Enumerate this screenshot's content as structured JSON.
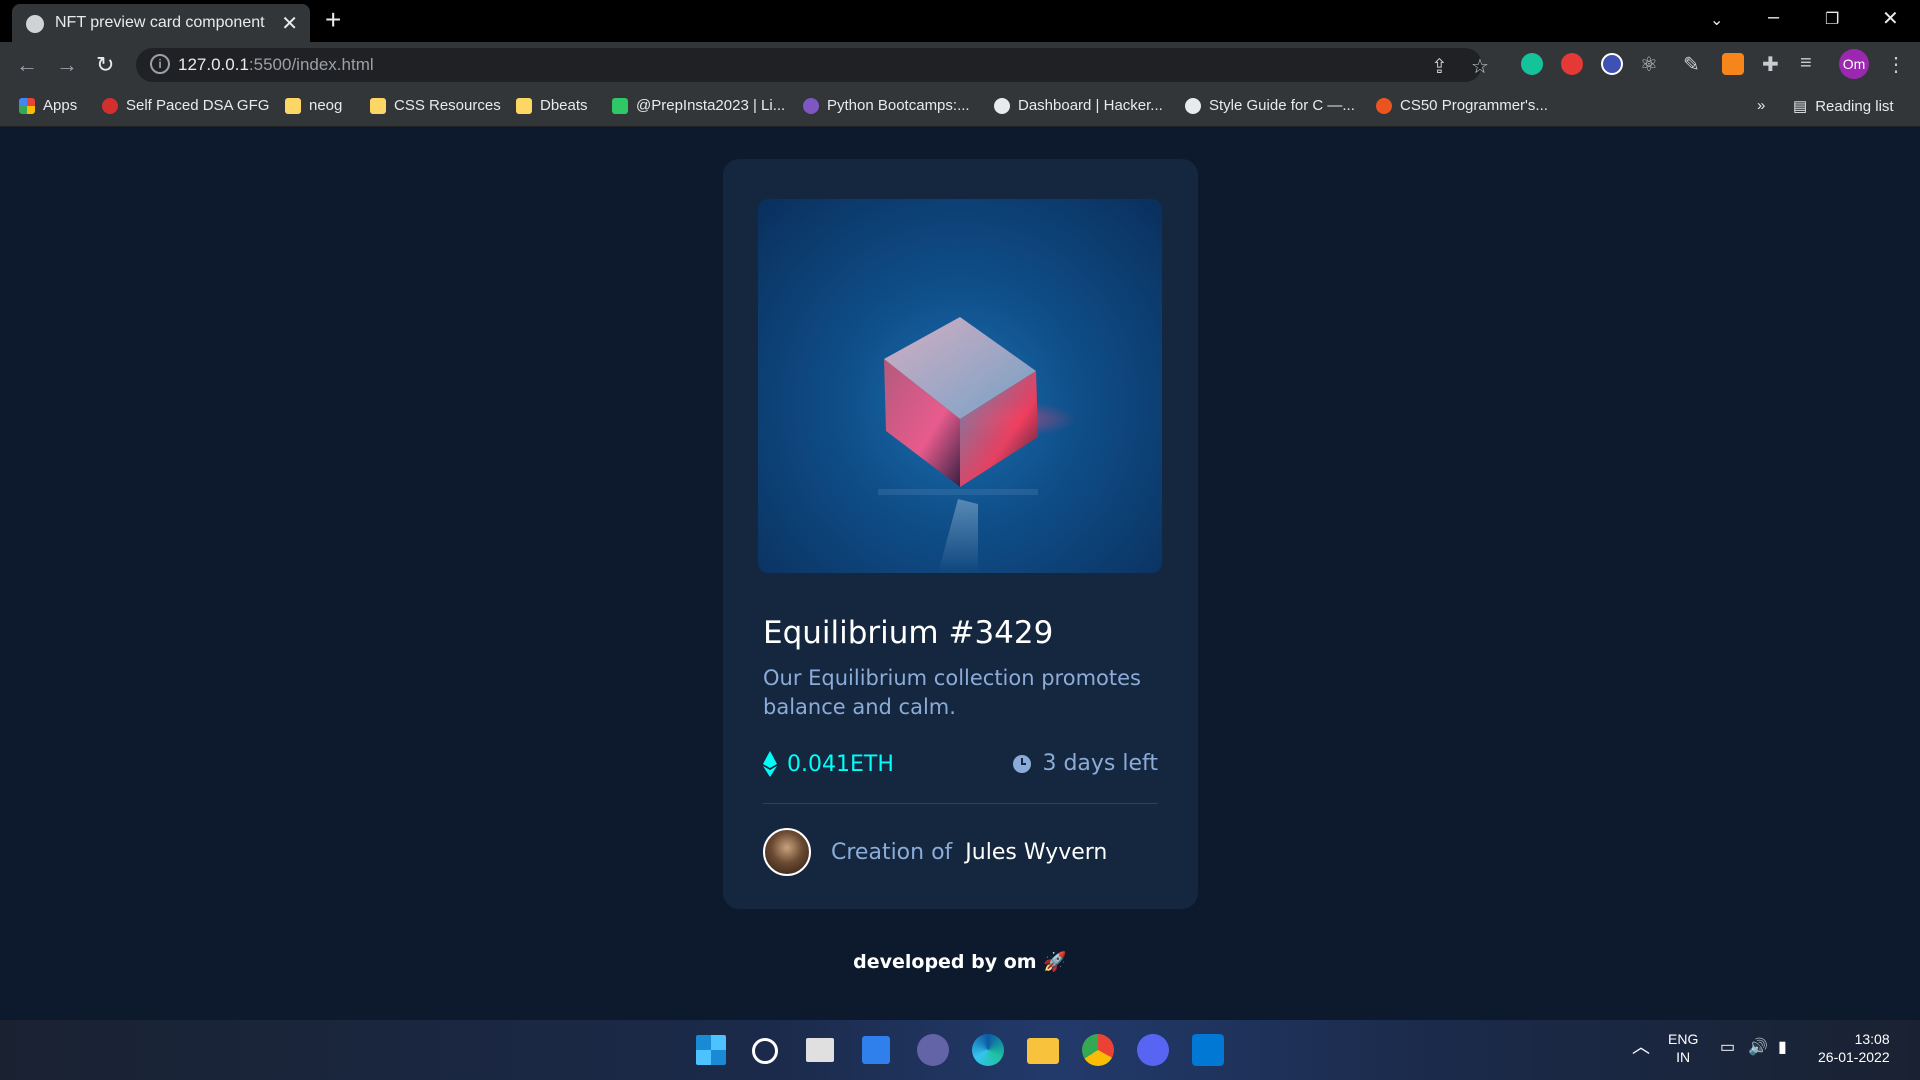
{
  "browser": {
    "tab_title": "NFT preview card component",
    "tab_close": "✕",
    "new_tab": "+",
    "url_host": "127.0.0.1",
    "url_rest": ":5500/index.html",
    "profile_initials": "Om",
    "reading_list": "Reading list",
    "bookmarks": [
      {
        "label": "Apps"
      },
      {
        "label": "Self Paced DSA GFG"
      },
      {
        "label": "neog"
      },
      {
        "label": "CSS Resources"
      },
      {
        "label": "Dbeats"
      },
      {
        "label": "@PrepInsta2023 | Li..."
      },
      {
        "label": "Python Bootcamps:..."
      },
      {
        "label": "Dashboard | Hacker..."
      },
      {
        "label": "Style Guide for C —..."
      },
      {
        "label": "CS50 Programmer's..."
      }
    ],
    "more": "»"
  },
  "card": {
    "title": "Equilibrium #3429",
    "description": "Our Equilibrium collection promotes balance and calm.",
    "price": "0.041ETH",
    "time_left": "3 days left",
    "creator_prefix": "Creation of",
    "creator_name": "Jules Wyvern"
  },
  "footer": {
    "text": "developed by om 🚀"
  },
  "taskbar": {
    "lang_top": "ENG",
    "lang_bottom": "IN",
    "time": "13:08",
    "date": "26-01-2022"
  },
  "colors": {
    "page_bg": "#0d192c",
    "card_bg": "#15263f",
    "cyan": "#00fff8",
    "soft_blue": "#8bacd9"
  }
}
